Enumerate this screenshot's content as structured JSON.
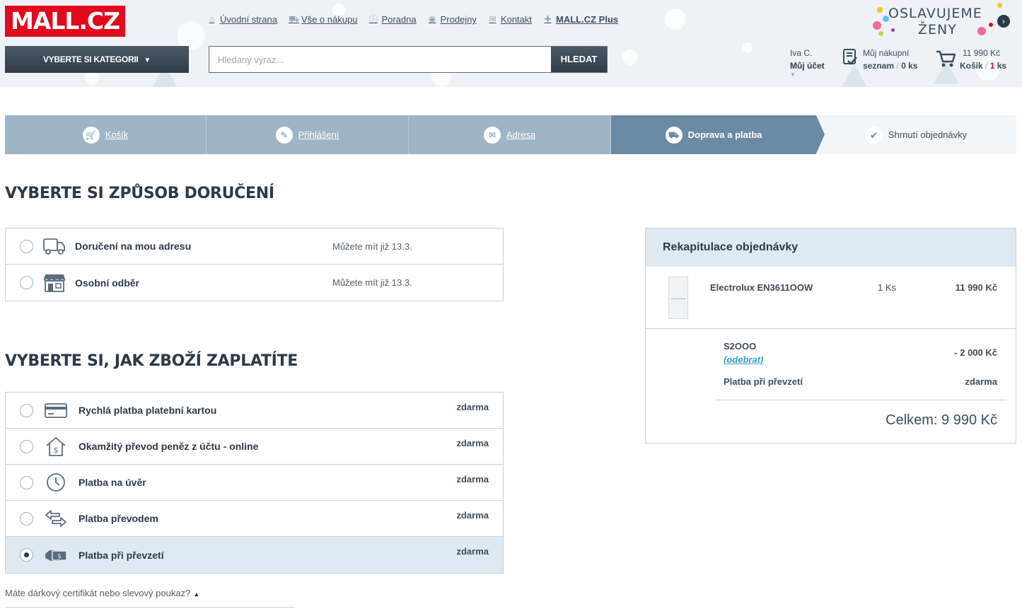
{
  "header": {
    "logo": "MALL.CZ",
    "nav": [
      {
        "label": "Úvodní strana",
        "icon": "home-icon"
      },
      {
        "label": "Vše o nákupu",
        "icon": "cart-icon"
      },
      {
        "label": "Poradna",
        "icon": "info-icon"
      },
      {
        "label": "Prodejny",
        "icon": "target-icon"
      },
      {
        "label": "Kontakt",
        "icon": "mail-icon"
      },
      {
        "label": "MALL.CZ Plus",
        "icon": "plus-icon"
      }
    ],
    "promo_line1": "OSLAVUJEME",
    "promo_line2": "ŽENY",
    "category_button": "VYBERTE SI KATEGORII",
    "search_placeholder": "Hledaný výraz...",
    "search_button": "HLEDAT",
    "account_name": "Iva C.",
    "account_label": "Můj účet",
    "wishlist_line1": "Můj nákupní",
    "wishlist_label": "seznam",
    "wishlist_count": "0 ks",
    "cart_price": "11 990 Kč",
    "cart_label": "Košík",
    "cart_count": "1",
    "cart_unit": "ks"
  },
  "steps": [
    {
      "label": "Košík",
      "icon": "cart-icon",
      "state": "done"
    },
    {
      "label": "Přihlášení",
      "icon": "pencil-icon",
      "state": "done"
    },
    {
      "label": "Adresa",
      "icon": "mail-icon",
      "state": "done"
    },
    {
      "label": "Doprava a platba",
      "icon": "truck-icon",
      "state": "active"
    },
    {
      "label": "Shrnutí objednávky",
      "icon": "check-icon",
      "state": "todo"
    }
  ],
  "delivery": {
    "title": "VYBERTE SI ZPŮSOB DORUČENÍ",
    "options": [
      {
        "label": "Doručení na mou adresu",
        "when": "Můžete mít již 13.3.",
        "icon": "truck-icon",
        "selected": false
      },
      {
        "label": "Osobní odběr",
        "when": "Můžete mít již 13.3.",
        "icon": "store-icon",
        "selected": false
      }
    ]
  },
  "payment": {
    "title": "VYBERTE SI, JAK ZBOŽÍ ZAPLATÍTE",
    "options": [
      {
        "label": "Rychlá platba platební kartou",
        "price": "zdarma",
        "icon": "card-icon",
        "selected": false
      },
      {
        "label": "Okamžitý převod peněz z účtu - online",
        "price": "zdarma",
        "icon": "house-dollar-icon",
        "selected": false
      },
      {
        "label": "Platba na úvěr",
        "price": "zdarma",
        "icon": "clock-icon",
        "selected": false
      },
      {
        "label": "Platba převodem",
        "price": "zdarma",
        "icon": "transfer-icon",
        "selected": false
      },
      {
        "label": "Platba při převzetí",
        "price": "zdarma",
        "icon": "cash-icon",
        "selected": true
      }
    ]
  },
  "summary": {
    "title": "Rekapitulace objednávky",
    "item_name": "Electrolux EN3611OOW",
    "item_qty": "1 Ks",
    "item_price": "11 990 Kč",
    "voucher_code": "S2OOO",
    "voucher_remove": "(odebrat)",
    "voucher_value": "- 2 000 Kč",
    "payment_label": "Platba při převzetí",
    "payment_price": "zdarma",
    "total": "Celkem: 9 990 Kč"
  },
  "gift_link": "Máte dárkový certifikát nebo slevový poukaz?"
}
